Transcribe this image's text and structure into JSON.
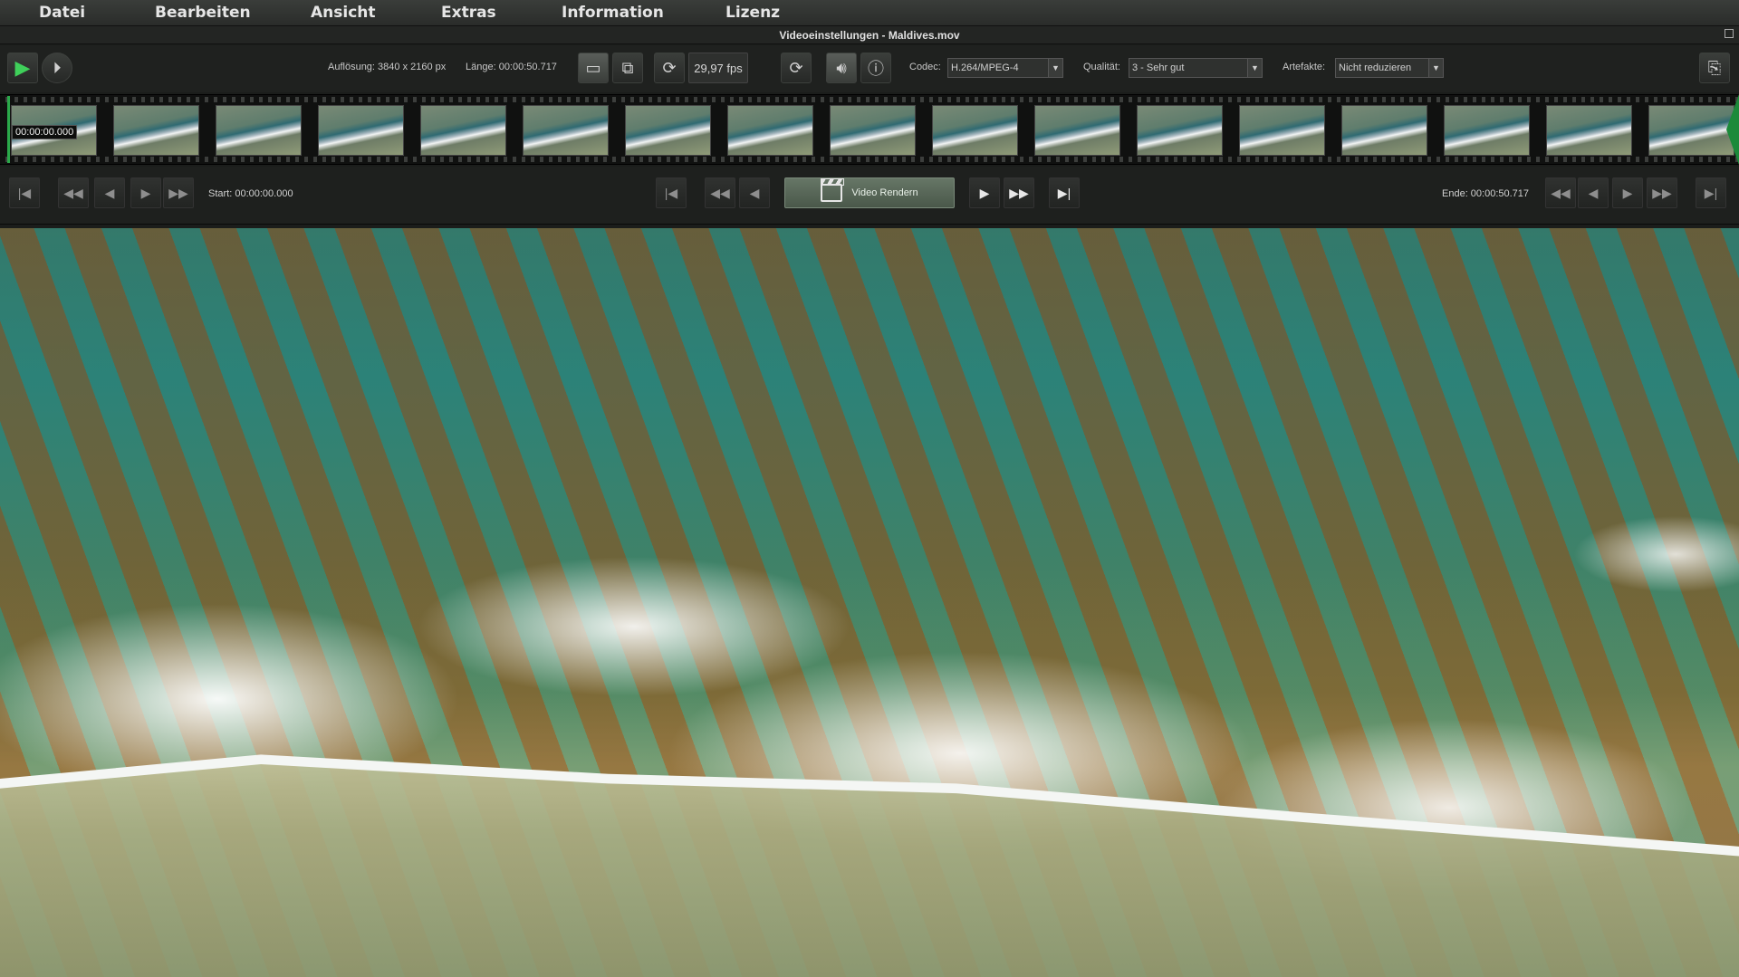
{
  "menu": {
    "items": [
      "Datei",
      "Bearbeiten",
      "Ansicht",
      "Extras",
      "Information",
      "Lizenz"
    ]
  },
  "window": {
    "title": "Videoeinstellungen - Maldives.mov"
  },
  "toolbar": {
    "resolution": "Auflösung: 3840 x 2160 px",
    "length": "Länge: 00:00:50.717",
    "fps": "29,97 fps",
    "codec_label": "Codec:",
    "codec_value": "H.264/MPEG-4",
    "quality_label": "Qualität:",
    "quality_value": "3 - Sehr gut",
    "artifacts_label": "Artefakte:",
    "artifacts_value": "Nicht reduzieren"
  },
  "filmstrip": {
    "timestamp": "00:00:00.000",
    "frame_count": 17
  },
  "transport": {
    "start": "Start: 00:00:00.000",
    "end": "Ende: 00:00:50.717",
    "render_label": "Video Rendern"
  },
  "colors": {
    "accent_green": "#2aa84a",
    "background": "#1b1d1b"
  }
}
